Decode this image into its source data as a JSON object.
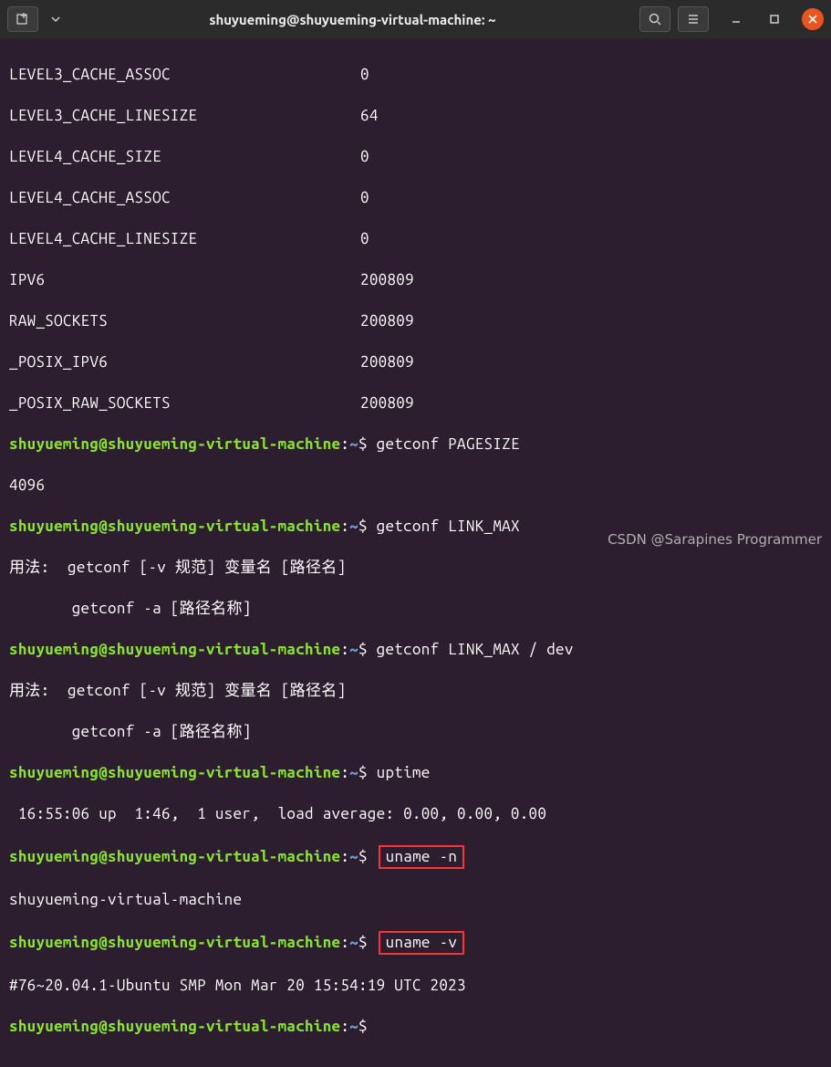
{
  "titlebar": {
    "title": "shuyueming@shuyueming-virtual-machine: ~"
  },
  "prompt": {
    "user_host": "shuyueming@shuyueming-virtual-machine",
    "path": "~",
    "sep": ":",
    "sigil": "$"
  },
  "conf_rows": [
    {
      "key": "LEVEL3_CACHE_ASSOC",
      "val": "0"
    },
    {
      "key": "LEVEL3_CACHE_LINESIZE",
      "val": "64"
    },
    {
      "key": "LEVEL4_CACHE_SIZE",
      "val": "0"
    },
    {
      "key": "LEVEL4_CACHE_ASSOC",
      "val": "0"
    },
    {
      "key": "LEVEL4_CACHE_LINESIZE",
      "val": "0"
    },
    {
      "key": "IPV6",
      "val": "200809"
    },
    {
      "key": "RAW_SOCKETS",
      "val": "200809"
    },
    {
      "key": "_POSIX_IPV6",
      "val": "200809"
    },
    {
      "key": "_POSIX_RAW_SOCKETS",
      "val": "200809"
    }
  ],
  "lines": {
    "cmd1": "getconf PAGESIZE",
    "out1": "4096",
    "cmd2": "getconf LINK_MAX",
    "usage1a": "用法:  getconf [-v 规范] 变量名 [路径名]",
    "usage1b": "       getconf -a [路径名称]",
    "cmd3": "getconf LINK_MAX / dev",
    "usage2a": "用法:  getconf [-v 规范] 变量名 [路径名]",
    "usage2b": "       getconf -a [路径名称]",
    "cmd4": "uptime",
    "uptime_out": " 16:55:06 up  1:46,  1 user,  load average: 0.00, 0.00, 0.00",
    "cmd5": "uname -n",
    "uname_n_out": "shuyueming-virtual-machine",
    "cmd6": "uname -v",
    "uname_v_out": "#76~20.04.1-Ubuntu SMP Mon Mar 20 15:54:19 UTC 2023"
  },
  "watermark": "CSDN @Sarapines Programmer"
}
